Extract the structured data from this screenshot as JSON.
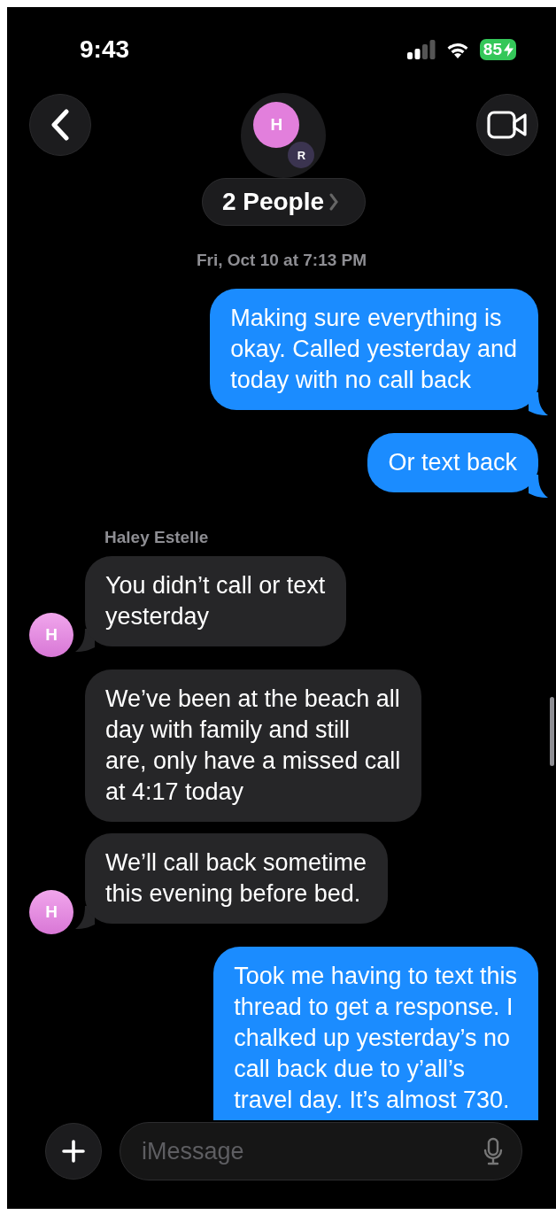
{
  "status_bar": {
    "time": "9:43",
    "battery": "85"
  },
  "header": {
    "group_avatars": [
      {
        "initial": "H",
        "color": "#e27fdc"
      },
      {
        "initial": "R",
        "color": "#3b3450"
      }
    ],
    "title": "2 People"
  },
  "timestamp": "Fri, Oct 10 at 7:13 PM",
  "messages": [
    {
      "kind": "sent",
      "text": "Making sure everything is\nokay. Called yesterday and\ntoday with no call back",
      "tail": true
    },
    {
      "kind": "sent",
      "text": "Or text back",
      "tail": true
    },
    {
      "kind": "sender_name",
      "text": "Haley Estelle"
    },
    {
      "kind": "received",
      "text": "You didn’t call or text\nyesterday",
      "tail": true,
      "avatar": "H"
    },
    {
      "kind": "received",
      "text": "We’ve been at the beach all\nday with family and still\nare, only have a missed call\nat 4:17 today",
      "tail": false
    },
    {
      "kind": "received",
      "text": "We’ll call back sometime\nthis evening before bed.",
      "tail": true,
      "avatar": "H"
    },
    {
      "kind": "sent",
      "text": "Took me having to text this\nthread to get a response. I\nchalked up yesterday’s no\ncall back due to y’all’s\ntravel day. It’s almost 730.",
      "tail": false
    }
  ],
  "composer": {
    "placeholder": "iMessage"
  }
}
